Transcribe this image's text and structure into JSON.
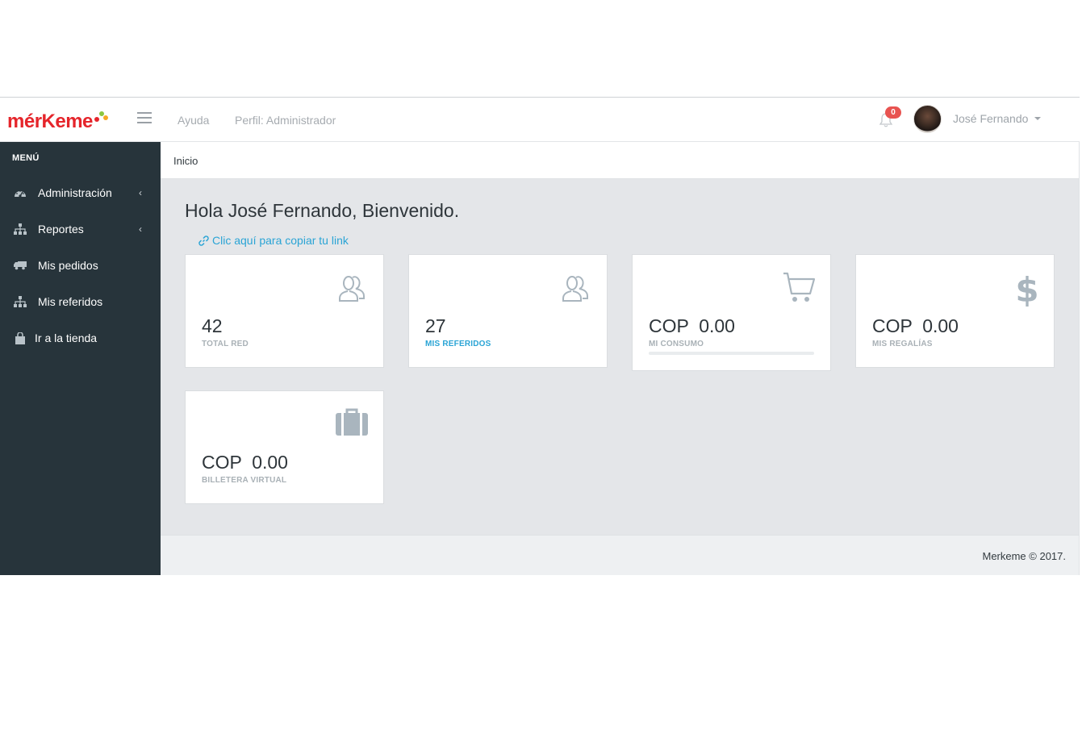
{
  "brand": {
    "logo_text": "mérKeme",
    "dot_colors": [
      "#e5252b",
      "#8cc63f",
      "#f7a823"
    ]
  },
  "header": {
    "nav": [
      {
        "label": "Ayuda"
      },
      {
        "label": "Perfil: Administrador"
      }
    ],
    "notifications": {
      "count": "0",
      "badge_color": "#e85350"
    },
    "user": {
      "name": "José Fernando"
    }
  },
  "sidebar": {
    "title": "MENÚ",
    "bg_color": "#27343b",
    "items": [
      {
        "label": "Administración",
        "icon": "dashboard-icon",
        "has_submenu": true
      },
      {
        "label": "Reportes",
        "icon": "sitemap-icon",
        "has_submenu": true
      },
      {
        "label": "Mis pedidos",
        "icon": "truck-icon",
        "has_submenu": false
      },
      {
        "label": "Mis referidos",
        "icon": "sitemap-icon",
        "has_submenu": false
      },
      {
        "label": "Ir a la tienda",
        "icon": "shopping-bag-icon",
        "has_submenu": false
      }
    ]
  },
  "breadcrumb": "Inicio",
  "main": {
    "greeting": "Hola José Fernando, Bienvenido.",
    "copy_link": "Clic aquí para copiar tu link",
    "cards": [
      {
        "value": "42",
        "label": "TOTAL RED",
        "icon": "users-icon",
        "label_highlight": false
      },
      {
        "value": "27",
        "label": "MIS REFERIDOS",
        "icon": "users-icon",
        "label_highlight": true
      },
      {
        "value": "COP  0.00",
        "label": "MI CONSUMO",
        "icon": "shopping-cart-icon",
        "progress": 0
      },
      {
        "value": "COP  0.00",
        "label": "MIS REGALÍAS",
        "icon": "dollar-icon"
      },
      {
        "value": "COP  0.00",
        "label": "BILLETERA VIRTUAL",
        "icon": "briefcase-icon"
      }
    ]
  },
  "footer": {
    "text": "Merkeme © 2017."
  },
  "colors": {
    "accent": "#2aa4d5",
    "content_bg": "#e4e6e9",
    "icon_gray": "#a9b5be"
  }
}
